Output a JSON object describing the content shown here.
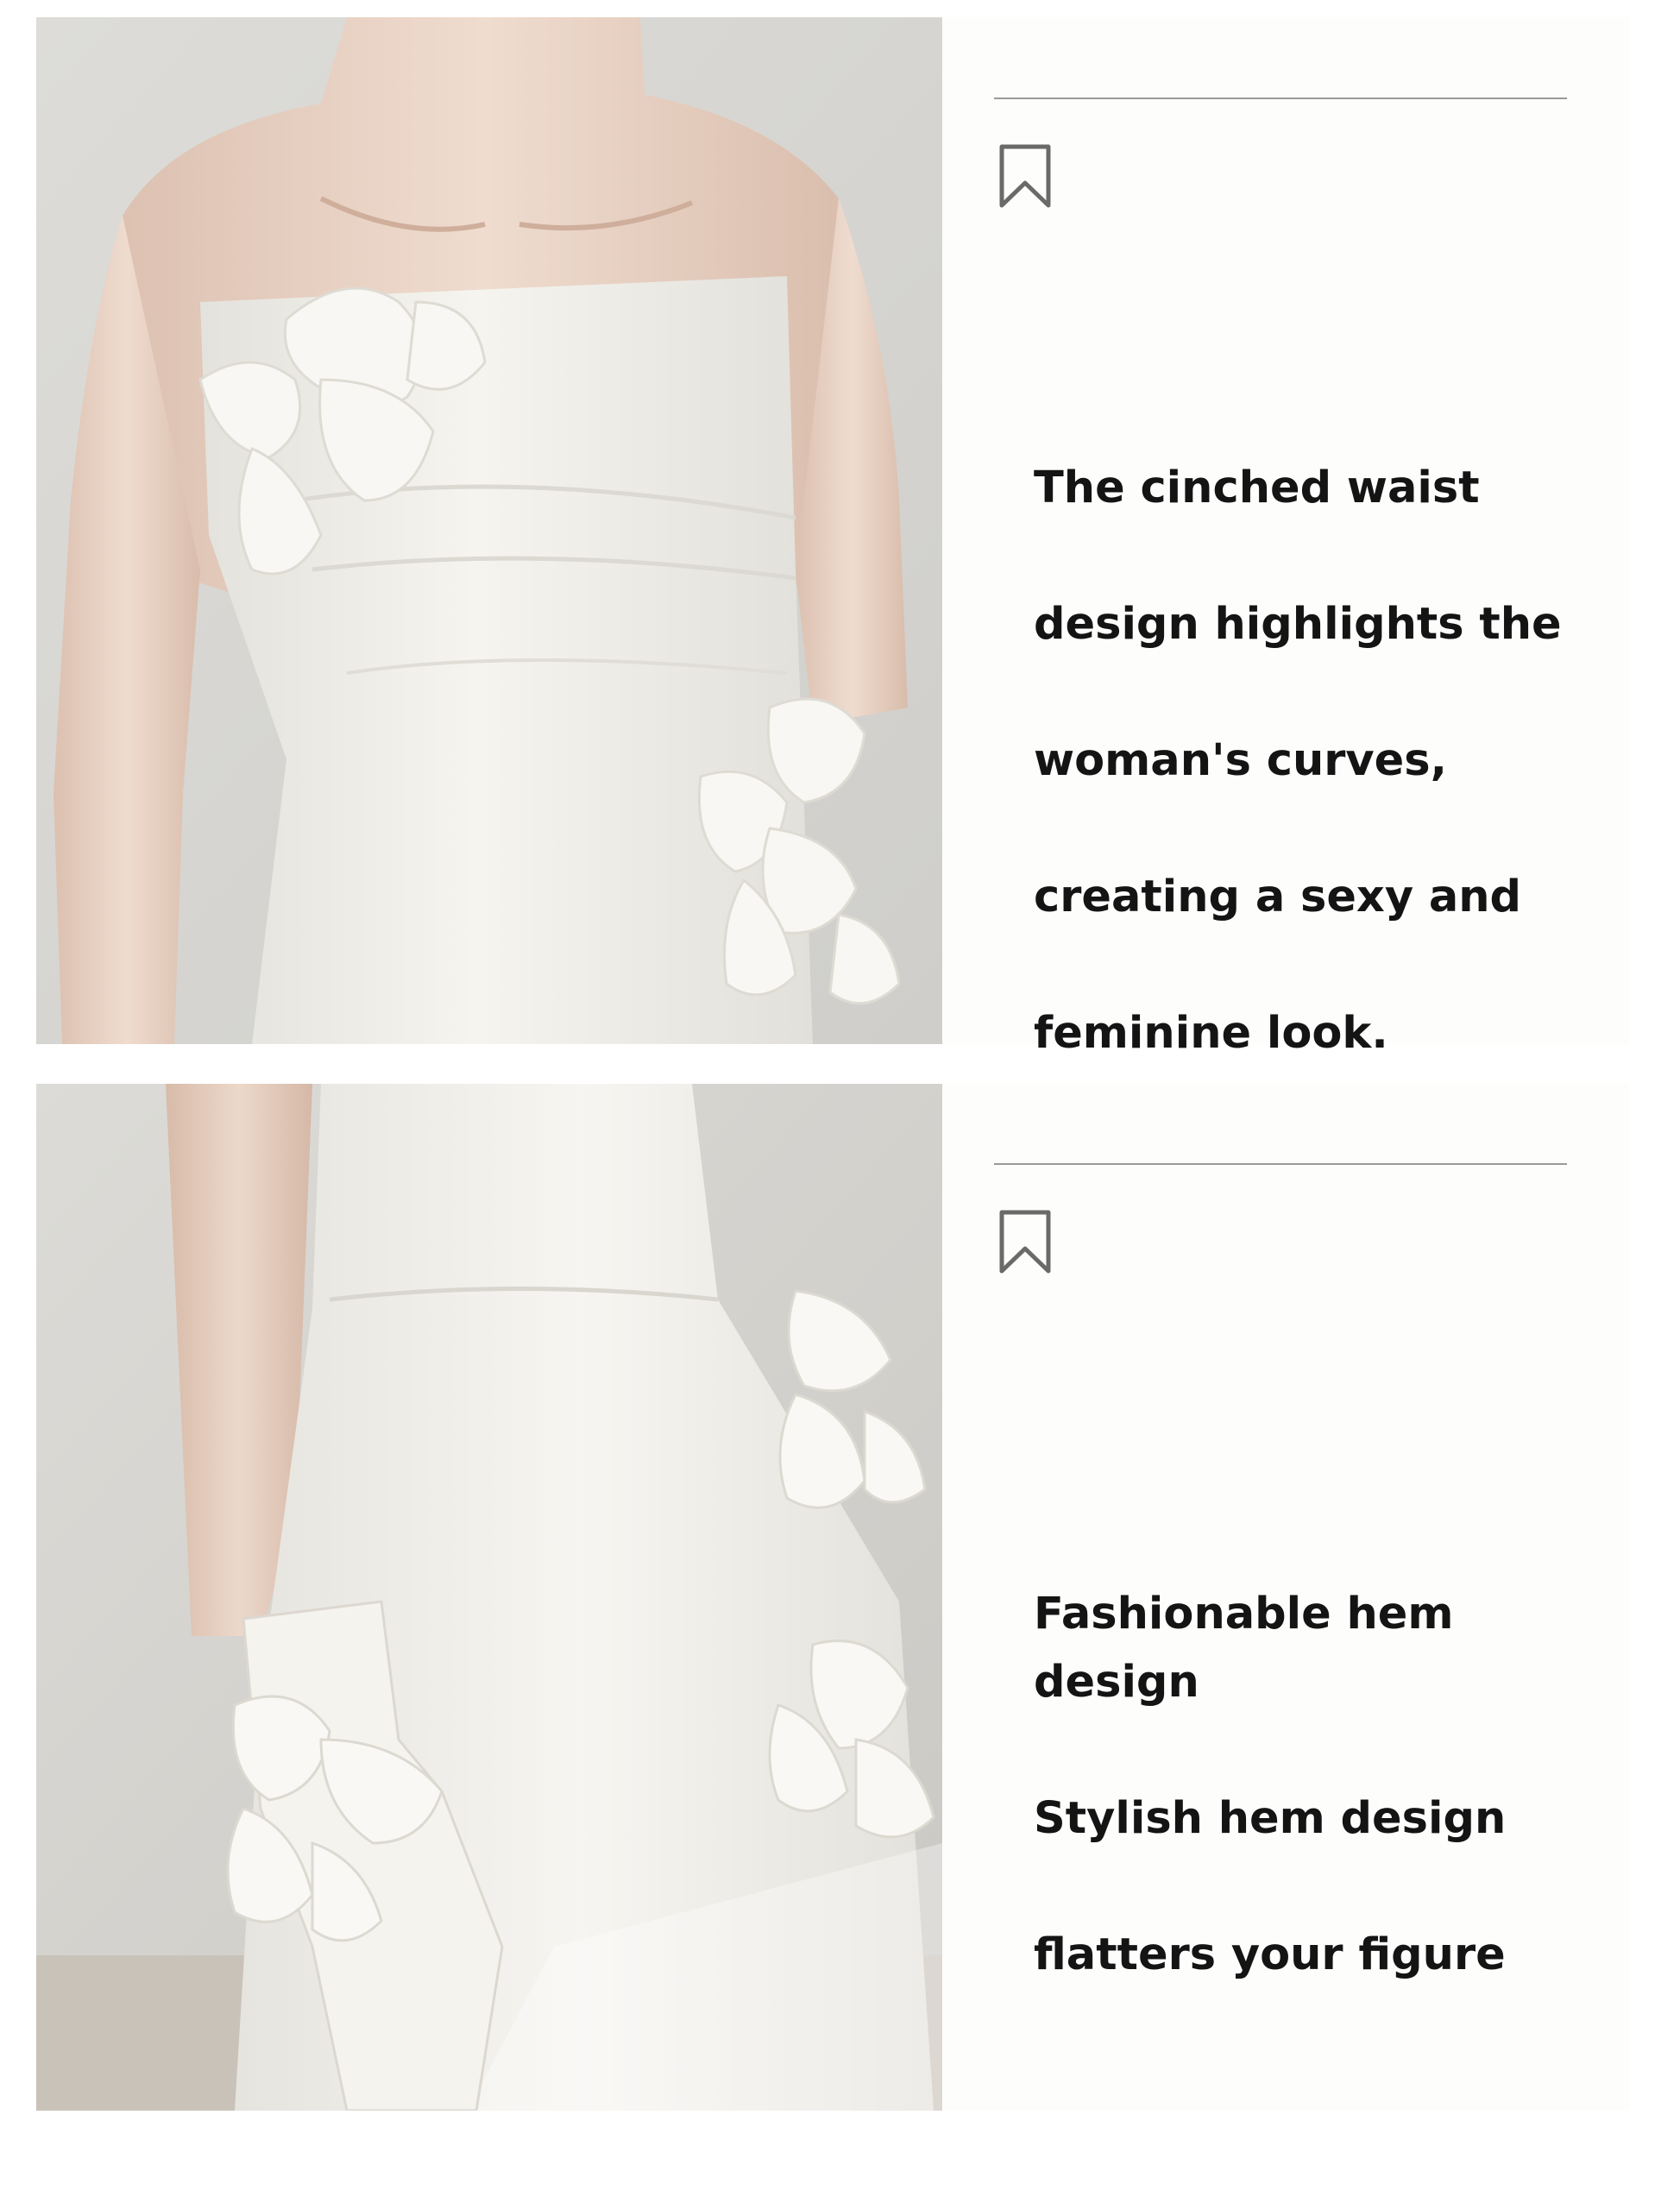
{
  "panels": [
    {
      "photo_subject": "strapless white dress bodice with 3D floral appliques",
      "bookmark_icon": "bookmark-outline-icon",
      "caption_lines": [
        "The cinched waist",
        "design highlights the",
        "woman's curves,",
        "creating a sexy and",
        "feminine look."
      ]
    },
    {
      "photo_subject": "white mini dress hem with floral appliques and gloved hand",
      "bookmark_icon": "bookmark-outline-icon",
      "caption_lines": [
        "Fashionable hem design",
        "Stylish hem design",
        "flatters your figure"
      ]
    }
  ],
  "colors": {
    "background": "#ffffff",
    "panel": "#fdfdfc",
    "rule": "#9a9a9a",
    "text": "#141414",
    "photo_backdrop": "#d9d8d4",
    "dress": "#f3f1ec",
    "skin": "#e9d2c4"
  }
}
